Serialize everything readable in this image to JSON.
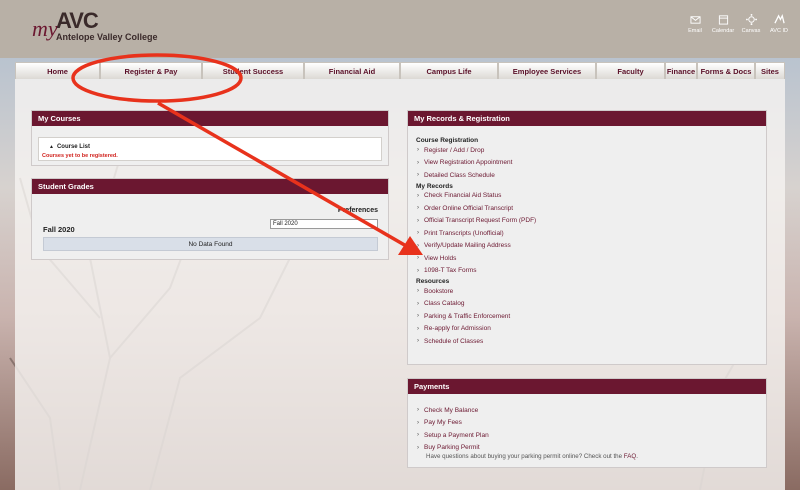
{
  "header": {
    "logo_my": "my",
    "logo_avc": "AVC",
    "logo_college": "Antelope Valley College",
    "icons": [
      {
        "name": "email-icon",
        "label": "Email"
      },
      {
        "name": "calendar-icon",
        "label": "Calendar"
      },
      {
        "name": "canvas-icon",
        "label": "Canvas"
      },
      {
        "name": "avc-id-icon",
        "label": "AVC ID"
      }
    ]
  },
  "tabs": [
    "Home",
    "Register & Pay",
    "Student Success",
    "Financial Aid",
    "Campus Life",
    "Employee Services",
    "Faculty",
    "Finance",
    "Forms & Docs",
    "Sites"
  ],
  "my_courses": {
    "title": "My Courses",
    "course_list": "Course List",
    "notice": "Courses yet to be registered."
  },
  "grades": {
    "title": "Student Grades",
    "preferences": "Preferences",
    "term": "Fall 2020",
    "select_value": "Fall 2020",
    "no_data": "No Data Found"
  },
  "records": {
    "title": "My Records & Registration",
    "course_registration": {
      "heading": "Course Registration",
      "links": [
        "Register / Add / Drop",
        "View Registration Appointment",
        "Detailed Class Schedule"
      ]
    },
    "my_records": {
      "heading": "My Records",
      "links": [
        "Check Financial Aid Status",
        "Order Online Official Transcript",
        "Official Transcript Request Form (PDF)",
        "Print Transcripts (Unofficial)",
        "Verify/Update Mailing Address",
        "View Holds",
        "1098-T Tax Forms"
      ]
    },
    "resources": {
      "heading": "Resources",
      "links": [
        "Bookstore",
        "Class Catalog",
        "Parking & Traffic Enforcement",
        "Re-apply for Admission",
        "Schedule of Classes"
      ]
    }
  },
  "payments": {
    "title": "Payments",
    "links": [
      "Check My Balance",
      "Pay My Fees",
      "Setup a Payment Plan",
      "Buy Parking Permit"
    ],
    "note": "Have questions about buying your parking permit online? Check out the",
    "faq": "FAQ",
    "period": "."
  },
  "colors": {
    "brand": "#6b1730",
    "annotation": "#e8321c"
  }
}
